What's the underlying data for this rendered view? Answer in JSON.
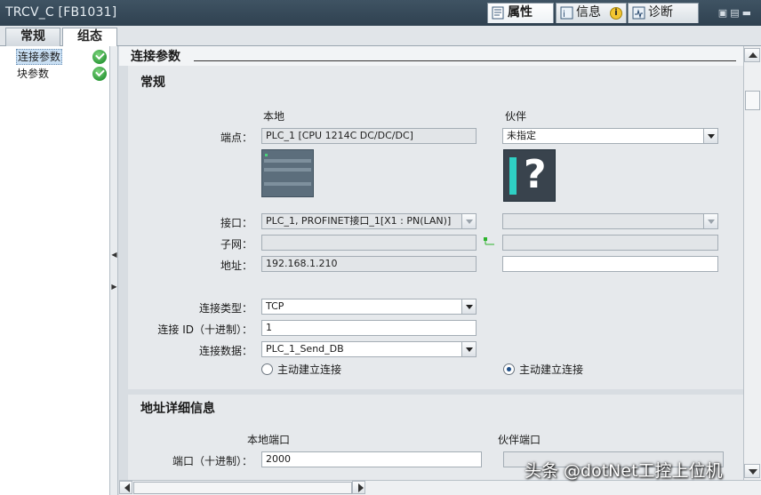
{
  "window": {
    "title": "TRCV_C [FB1031]",
    "panel_tabs": [
      {
        "label": "属性",
        "icon": "properties-icon",
        "active": true
      },
      {
        "label": "信息",
        "icon": "info-icon",
        "active": false
      },
      {
        "label": "诊断",
        "icon": "diagnostics-icon",
        "active": false
      }
    ]
  },
  "tabs": [
    "常规",
    "组态"
  ],
  "nav": {
    "items": [
      {
        "label": "连接参数",
        "selected": true,
        "status": "ok"
      },
      {
        "label": "块参数",
        "selected": false,
        "status": "ok"
      }
    ]
  },
  "section": {
    "title": "连接参数"
  },
  "general": {
    "title": "常规",
    "local_header": "本地",
    "partner_header": "伙伴",
    "endpoint_label": "端点：",
    "local_endpoint": "PLC_1 [CPU 1214C DC/DC/DC]",
    "partner_endpoint": "未指定",
    "interface_label": "接口：",
    "local_interface": "PLC_1, PROFINET接口_1[X1 : PN(LAN)]",
    "partner_interface": "",
    "subnet_label": "子网：",
    "local_subnet": "",
    "partner_subnet": "",
    "address_label": "地址：",
    "local_address": "192.168.1.210",
    "partner_address": "",
    "conn_type_label": "连接类型：",
    "conn_type": "TCP",
    "conn_id_label": "连接 ID（十进制）：",
    "conn_id": "1",
    "conn_data_label": "连接数据：",
    "conn_data": "PLC_1_Send_DB",
    "local_active_label": "主动建立连接",
    "local_active_selected": false,
    "partner_active_label": "主动建立连接",
    "partner_active_selected": true
  },
  "address_details": {
    "title": "地址详细信息",
    "local_port_header": "本地端口",
    "partner_port_header": "伙伴端口",
    "port_label": "端口（十进制）：",
    "local_port": "2000",
    "partner_port": ""
  },
  "watermark": "头条 @dotNet工控上位机"
}
